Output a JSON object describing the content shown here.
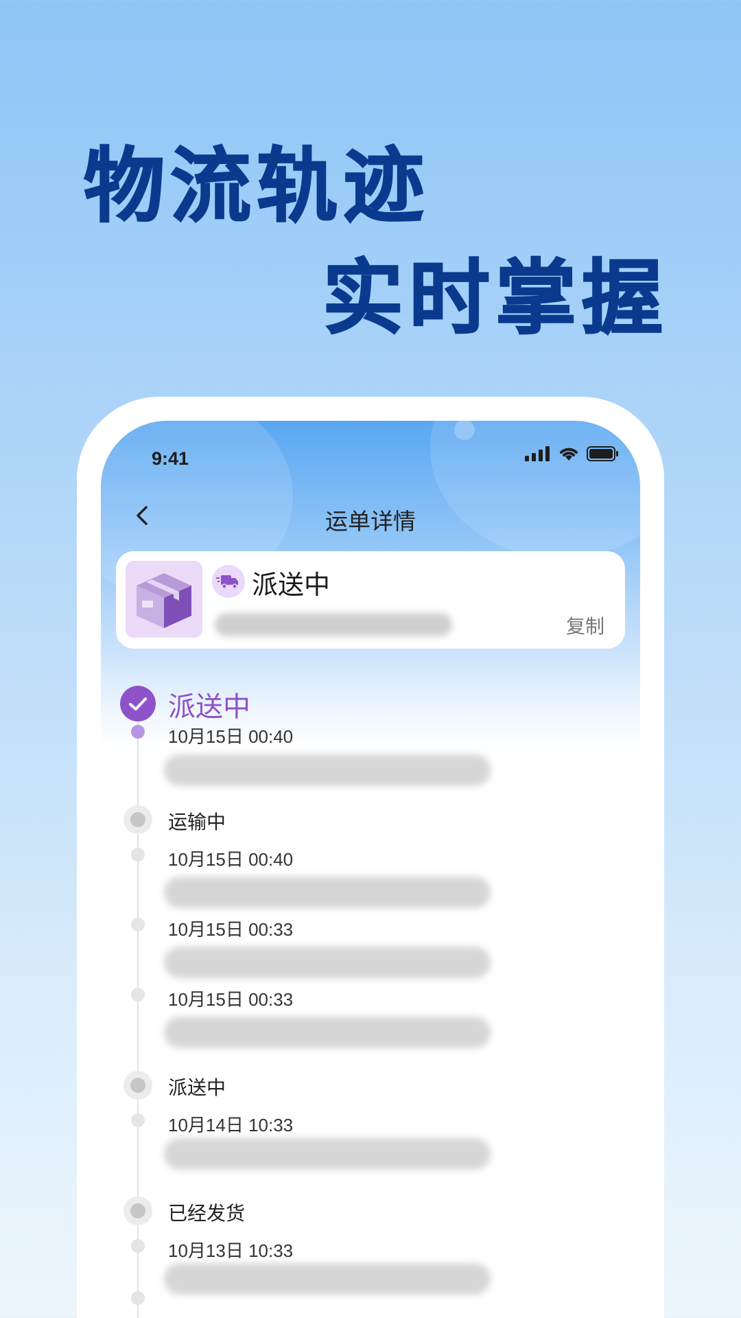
{
  "headline": {
    "line1": "物流轨迹",
    "line2": "实时掌握"
  },
  "status_bar": {
    "time": "9:41"
  },
  "nav": {
    "back_icon": "chevron-left-icon",
    "title": "运单详情"
  },
  "shipment_card": {
    "status": "派送中",
    "copy_label": "复制",
    "status_icon": "delivery-truck-icon",
    "thumbnail_icon": "package-box-icon"
  },
  "timeline": {
    "current": {
      "title": "派送中",
      "events": [
        {
          "time": "10月15日 00:40"
        }
      ]
    },
    "groups": [
      {
        "title": "运输中",
        "events": [
          {
            "time": "10月15日 00:40"
          },
          {
            "time": "10月15日 00:33"
          },
          {
            "time": "10月15日 00:33"
          }
        ]
      },
      {
        "title": "派送中",
        "events": [
          {
            "time": "10月14日 10:33"
          }
        ]
      },
      {
        "title": "已经发货",
        "events": [
          {
            "time": "10月13日 10:33"
          }
        ]
      }
    ]
  },
  "colors": {
    "headline": "#0a3a8e",
    "accent_purple": "#8e52c9",
    "screen_top": "#5aa7f2"
  }
}
